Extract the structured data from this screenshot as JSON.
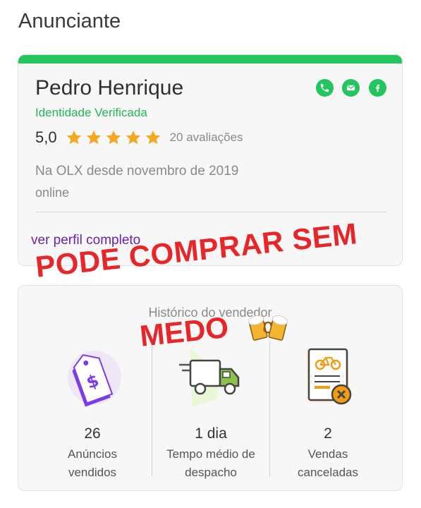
{
  "section": {
    "title": "Anunciante"
  },
  "seller": {
    "name": "Pedro Henrique",
    "verified_label": "Identidade Verificada",
    "rating": "5,0",
    "stars": 5,
    "reviews": "20 avaliações",
    "since": "Na OLX desde novembro de 2019",
    "status": "online",
    "profile_link": "ver perfil completo",
    "contacts": [
      "phone-icon",
      "email-icon",
      "facebook-icon"
    ]
  },
  "history": {
    "title": "Histórico do vendedor",
    "stats": [
      {
        "value": "26",
        "line1": "Anúncios",
        "line2": "vendidos",
        "icon": "price-tag-icon"
      },
      {
        "value": "1 dia",
        "line1": "Tempo médio de",
        "line2": "despacho",
        "icon": "delivery-truck-icon"
      },
      {
        "value": "2",
        "line1": "Vendas",
        "line2": "canceladas",
        "icon": "cancelled-order-icon"
      }
    ]
  },
  "overlay": {
    "line1": "PODE COMPRAR SEM",
    "line2": "MEDO",
    "emoji": "🍻"
  },
  "colors": {
    "accent_green": "#22c55e",
    "link_purple": "#6b21a8",
    "overlay_red": "#e8262a",
    "star_gold": "#f5a623"
  }
}
